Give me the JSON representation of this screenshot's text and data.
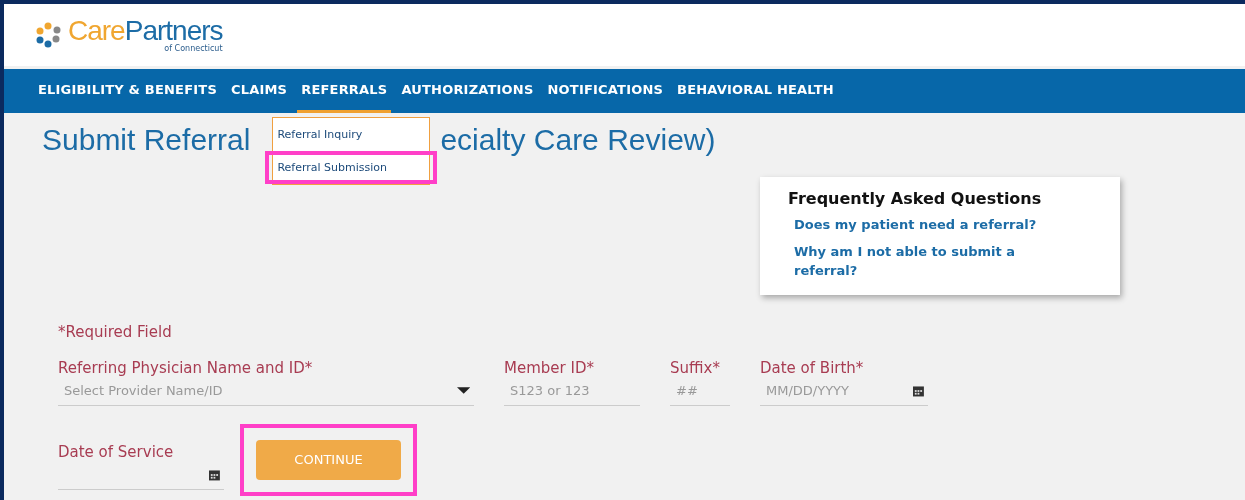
{
  "logo": {
    "name_parts": [
      "Care",
      "Partners"
    ],
    "subtitle": "of Connecticut"
  },
  "nav": [
    {
      "label": "ELIGIBILITY & BENEFITS",
      "selected": false
    },
    {
      "label": "CLAIMS",
      "selected": false
    },
    {
      "label": "REFERRALS",
      "selected": true
    },
    {
      "label": "AUTHORIZATIONS",
      "selected": false
    },
    {
      "label": "NOTIFICATIONS",
      "selected": false
    },
    {
      "label": "BEHAVIORAL HEALTH",
      "selected": false
    }
  ],
  "dropdown": [
    {
      "label": "Referral Inquiry",
      "highlighted": false
    },
    {
      "label": "Referral Submission",
      "highlighted": true
    }
  ],
  "title_parts": [
    "Submit Referral",
    "ecialty Care Review)"
  ],
  "faq": {
    "title": "Frequently Asked Questions",
    "links": [
      "Does my patient need a referral?",
      "Why am I not able to submit a referral?"
    ]
  },
  "required_note": "*Required Field",
  "fields": [
    {
      "label": "Referring Physician Name and ID*",
      "placeholder": "Select Provider Name/ID",
      "kind": "select"
    },
    {
      "label": "Member ID*",
      "placeholder": "S123 or 123",
      "kind": "text"
    },
    {
      "label": "Suffix*",
      "placeholder": "##",
      "kind": "text"
    },
    {
      "label": "Date of Birth*",
      "placeholder": "MM/DD/YYYY",
      "kind": "date"
    },
    {
      "label": "Date of Service",
      "kind": "date"
    }
  ],
  "continue_button": {
    "label": "CONTINUE",
    "highlighted": true
  }
}
